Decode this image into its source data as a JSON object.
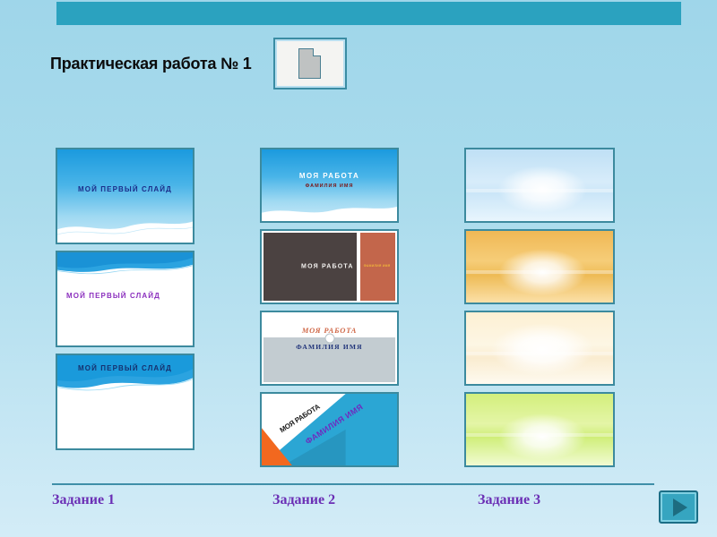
{
  "header": {
    "title": "Практическая работа № 1",
    "doc_icon": "document-icon",
    "bar_color": "#2ba2bf"
  },
  "background": {
    "gradient_top": "#9fd6ea",
    "gradient_bottom": "#d3ecf7"
  },
  "columns": [
    {
      "id": "task-1",
      "footer_label": "Задание 1",
      "slides": [
        {
          "name": "slide-blue-gradient-wave",
          "line1": "МОЙ ПЕРВЫЙ СЛАЙД",
          "line1_color": "#1b2d8a"
        },
        {
          "name": "slide-white-top-band",
          "line1": "МОЙ ПЕРВЫЙ СЛАЙД",
          "line1_color": "#8b2fbe"
        },
        {
          "name": "slide-blue-band-header",
          "line1": "МОЙ ПЕРВЫЙ СЛАЙД",
          "line1_color": "#16306e"
        }
      ]
    },
    {
      "id": "task-2",
      "footer_label": "Задание 2",
      "slides": [
        {
          "name": "slide-blue-title",
          "line1": "МОЯ РАБОТА",
          "line2": "ФАМИЛИЯ ИМЯ",
          "line1_color": "#ffffff",
          "line2_color": "#7a1414"
        },
        {
          "name": "slide-brown-strip",
          "line1": "МОЯ РАБОТА",
          "line2": "ФАМИЛИЯ ИМЯ",
          "line1_color": "#f2f0ee",
          "line2_color": "#f0b43a"
        },
        {
          "name": "slide-gray-serif",
          "line1": "МОЯ РАБОТА",
          "line2": "ФАМИЛИЯ ИМЯ",
          "line1_color": "#d06a4a",
          "line2_color": "#21347a"
        },
        {
          "name": "slide-diagonal-cyan",
          "line1": "МОЯ РАБОТА",
          "line2": "ФАМИЛИЯ ИМЯ",
          "line1_color": "#1a1a1a",
          "line2_color": "#6e2bbf"
        }
      ]
    },
    {
      "id": "task-3",
      "footer_label": "Задание 3",
      "slides": [
        {
          "name": "slide-gradient-blue",
          "accent": "#bfe0f5"
        },
        {
          "name": "slide-gradient-orange",
          "accent": "#f0b855"
        },
        {
          "name": "slide-gradient-cream",
          "accent": "#fdf0d3"
        },
        {
          "name": "slide-gradient-green",
          "accent": "#d3ef7c"
        }
      ]
    }
  ],
  "footer": {
    "next_button": "next-arrow-button",
    "rule_color": "#3f8fa8",
    "label_color": "#6b2fb5"
  }
}
